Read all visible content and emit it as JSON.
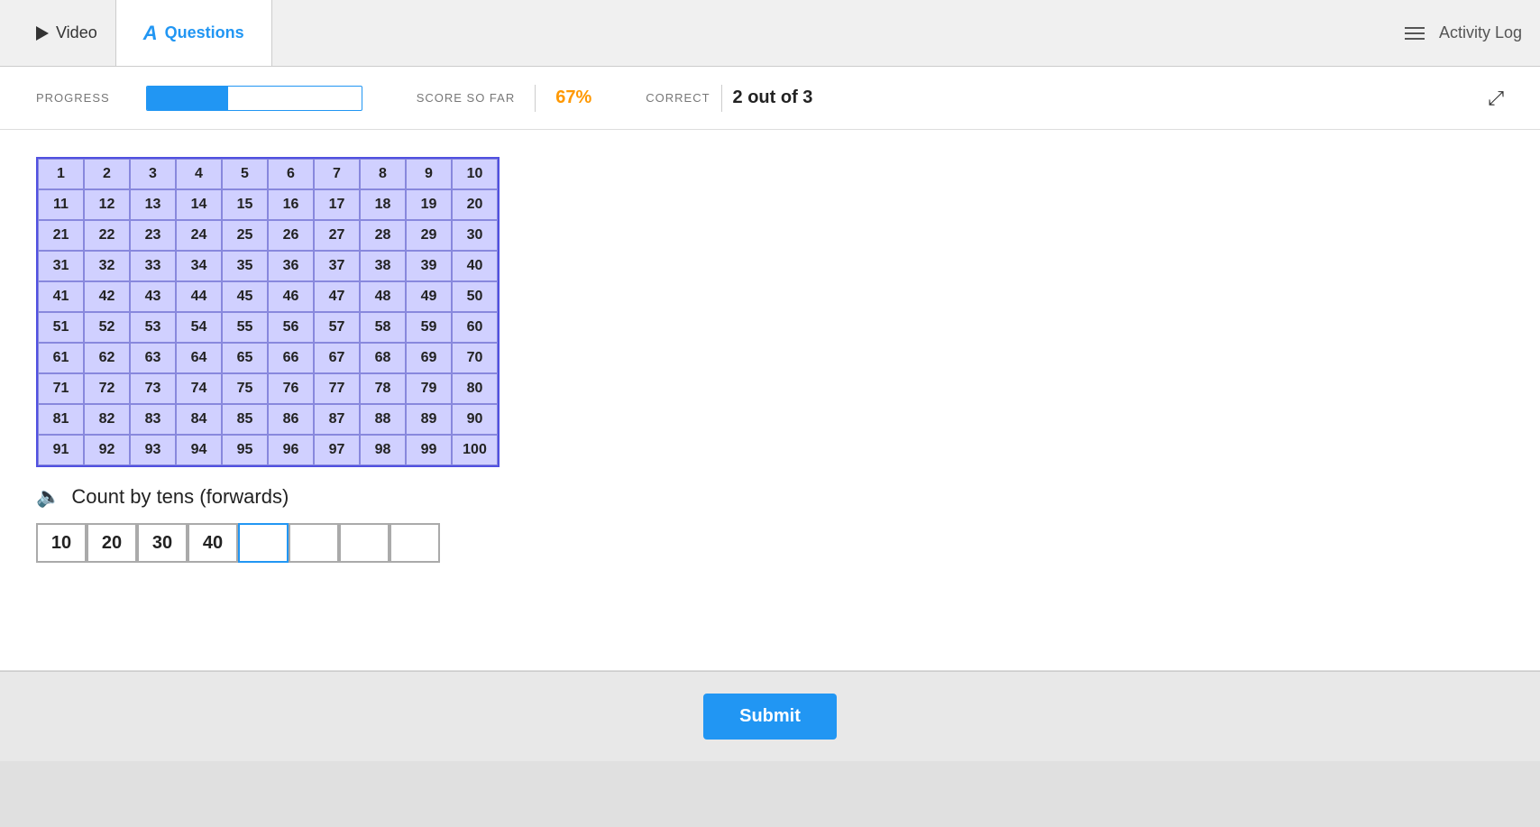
{
  "nav": {
    "video_label": "Video",
    "questions_label": "Questions",
    "activity_log_label": "Activity Log"
  },
  "progress": {
    "label": "PROGRESS",
    "fill_percent": 38,
    "score_label": "SCORE SO FAR",
    "score_value": "67%",
    "correct_label": "CORRECT",
    "correct_value": "2 out of 3"
  },
  "grid": {
    "numbers": [
      [
        1,
        2,
        3,
        4,
        5,
        6,
        7,
        8,
        9,
        10
      ],
      [
        11,
        12,
        13,
        14,
        15,
        16,
        17,
        18,
        19,
        20
      ],
      [
        21,
        22,
        23,
        24,
        25,
        26,
        27,
        28,
        29,
        30
      ],
      [
        31,
        32,
        33,
        34,
        35,
        36,
        37,
        38,
        39,
        40
      ],
      [
        41,
        42,
        43,
        44,
        45,
        46,
        47,
        48,
        49,
        50
      ],
      [
        51,
        52,
        53,
        54,
        55,
        56,
        57,
        58,
        59,
        60
      ],
      [
        61,
        62,
        63,
        64,
        65,
        66,
        67,
        68,
        69,
        70
      ],
      [
        71,
        72,
        73,
        74,
        75,
        76,
        77,
        78,
        79,
        80
      ],
      [
        81,
        82,
        83,
        84,
        85,
        86,
        87,
        88,
        89,
        90
      ],
      [
        91,
        92,
        93,
        94,
        95,
        96,
        97,
        98,
        99,
        100
      ]
    ]
  },
  "question": {
    "text": "Count by tens (forwards)",
    "filled_answers": [
      "10",
      "20",
      "30",
      "40"
    ],
    "empty_count": 4
  },
  "footer": {
    "submit_label": "Submit"
  }
}
